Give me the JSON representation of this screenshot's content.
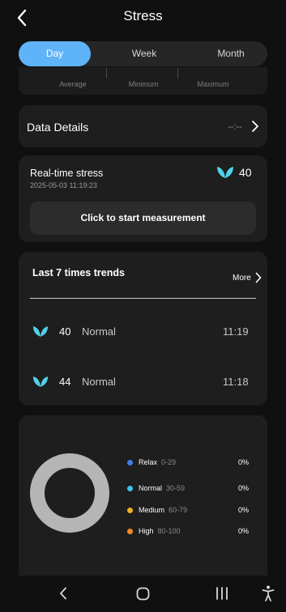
{
  "header": {
    "title": "Stress",
    "back_icon": "chevron-left-icon"
  },
  "tabs": [
    {
      "label": "Day",
      "active": true
    },
    {
      "label": "Week",
      "active": false
    },
    {
      "label": "Month",
      "active": false
    }
  ],
  "stats": {
    "average": "Average",
    "minimum": "Minimum",
    "maximum": "Maximum"
  },
  "data_details": {
    "label": "Data Details",
    "value": "--:--"
  },
  "realtime": {
    "title": "Real-time stress",
    "timestamp": "2025-05-03 11:19:23",
    "value": "40",
    "button": "Click to start measurement"
  },
  "trends": {
    "title": "Last 7 times trends",
    "more": "More",
    "rows": [
      {
        "value": "40",
        "level": "Normal",
        "time": "11:19"
      },
      {
        "value": "44",
        "level": "Normal",
        "time": "11:18"
      }
    ]
  },
  "distribution": {
    "items": [
      {
        "label": "Relax",
        "range": "0-29",
        "percent": "0%",
        "color": "#3d7fe6"
      },
      {
        "label": "Normal",
        "range": "30-59",
        "percent": "0%",
        "color": "#3fc3e6"
      },
      {
        "label": "Medium",
        "range": "60-79",
        "percent": "0%",
        "color": "#f2b022"
      },
      {
        "label": "High",
        "range": "80-100",
        "percent": "0%",
        "color": "#f08a24"
      }
    ]
  },
  "colors": {
    "accent": "#5fb3f8",
    "leaf": "#4fd1e8",
    "donut_empty": "#b5b5b5"
  }
}
